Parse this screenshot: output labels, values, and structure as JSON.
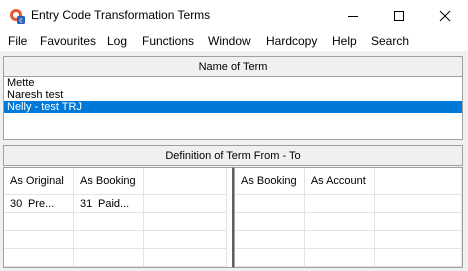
{
  "window": {
    "title": "Entry Code Transformation Terms",
    "icon": "app-icon",
    "controls": [
      "minimize-icon",
      "maximize-icon",
      "close-icon"
    ]
  },
  "menu": [
    "File",
    "Favourites",
    "Log",
    "Functions",
    "Window",
    "Hardcopy",
    "Help",
    "Search"
  ],
  "name_section": {
    "header": "Name of Term",
    "items": [
      "Mette",
      "Naresh test",
      "Nelly - test TRJ"
    ],
    "selected_index": 2
  },
  "definition_section": {
    "header": "Definition of Term From - To",
    "left": {
      "columns": [
        "As Original",
        "As Booking"
      ],
      "rows": [
        {
          "orig_num": "30",
          "orig_text": "Pre...",
          "book_num": "31",
          "book_text": "Paid..."
        }
      ]
    },
    "right": {
      "columns": [
        "As Booking",
        "As Account"
      ]
    }
  },
  "colors": {
    "selection": "#0078d7",
    "window_bg": "#f0f0f0",
    "border": "#a0a0a0"
  }
}
